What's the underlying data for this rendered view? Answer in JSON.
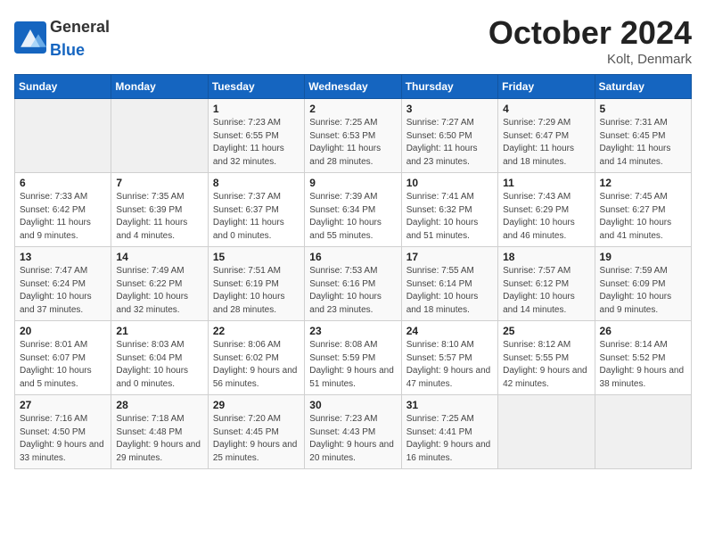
{
  "logo": {
    "general": "General",
    "blue": "Blue"
  },
  "header": {
    "title": "October 2024",
    "location": "Kolt, Denmark"
  },
  "weekdays": [
    "Sunday",
    "Monday",
    "Tuesday",
    "Wednesday",
    "Thursday",
    "Friday",
    "Saturday"
  ],
  "weeks": [
    [
      {
        "day": "",
        "empty": true
      },
      {
        "day": "",
        "empty": true
      },
      {
        "day": "1",
        "sunrise": "Sunrise: 7:23 AM",
        "sunset": "Sunset: 6:55 PM",
        "daylight": "Daylight: 11 hours and 32 minutes."
      },
      {
        "day": "2",
        "sunrise": "Sunrise: 7:25 AM",
        "sunset": "Sunset: 6:53 PM",
        "daylight": "Daylight: 11 hours and 28 minutes."
      },
      {
        "day": "3",
        "sunrise": "Sunrise: 7:27 AM",
        "sunset": "Sunset: 6:50 PM",
        "daylight": "Daylight: 11 hours and 23 minutes."
      },
      {
        "day": "4",
        "sunrise": "Sunrise: 7:29 AM",
        "sunset": "Sunset: 6:47 PM",
        "daylight": "Daylight: 11 hours and 18 minutes."
      },
      {
        "day": "5",
        "sunrise": "Sunrise: 7:31 AM",
        "sunset": "Sunset: 6:45 PM",
        "daylight": "Daylight: 11 hours and 14 minutes."
      }
    ],
    [
      {
        "day": "6",
        "sunrise": "Sunrise: 7:33 AM",
        "sunset": "Sunset: 6:42 PM",
        "daylight": "Daylight: 11 hours and 9 minutes."
      },
      {
        "day": "7",
        "sunrise": "Sunrise: 7:35 AM",
        "sunset": "Sunset: 6:39 PM",
        "daylight": "Daylight: 11 hours and 4 minutes."
      },
      {
        "day": "8",
        "sunrise": "Sunrise: 7:37 AM",
        "sunset": "Sunset: 6:37 PM",
        "daylight": "Daylight: 11 hours and 0 minutes."
      },
      {
        "day": "9",
        "sunrise": "Sunrise: 7:39 AM",
        "sunset": "Sunset: 6:34 PM",
        "daylight": "Daylight: 10 hours and 55 minutes."
      },
      {
        "day": "10",
        "sunrise": "Sunrise: 7:41 AM",
        "sunset": "Sunset: 6:32 PM",
        "daylight": "Daylight: 10 hours and 51 minutes."
      },
      {
        "day": "11",
        "sunrise": "Sunrise: 7:43 AM",
        "sunset": "Sunset: 6:29 PM",
        "daylight": "Daylight: 10 hours and 46 minutes."
      },
      {
        "day": "12",
        "sunrise": "Sunrise: 7:45 AM",
        "sunset": "Sunset: 6:27 PM",
        "daylight": "Daylight: 10 hours and 41 minutes."
      }
    ],
    [
      {
        "day": "13",
        "sunrise": "Sunrise: 7:47 AM",
        "sunset": "Sunset: 6:24 PM",
        "daylight": "Daylight: 10 hours and 37 minutes."
      },
      {
        "day": "14",
        "sunrise": "Sunrise: 7:49 AM",
        "sunset": "Sunset: 6:22 PM",
        "daylight": "Daylight: 10 hours and 32 minutes."
      },
      {
        "day": "15",
        "sunrise": "Sunrise: 7:51 AM",
        "sunset": "Sunset: 6:19 PM",
        "daylight": "Daylight: 10 hours and 28 minutes."
      },
      {
        "day": "16",
        "sunrise": "Sunrise: 7:53 AM",
        "sunset": "Sunset: 6:16 PM",
        "daylight": "Daylight: 10 hours and 23 minutes."
      },
      {
        "day": "17",
        "sunrise": "Sunrise: 7:55 AM",
        "sunset": "Sunset: 6:14 PM",
        "daylight": "Daylight: 10 hours and 18 minutes."
      },
      {
        "day": "18",
        "sunrise": "Sunrise: 7:57 AM",
        "sunset": "Sunset: 6:12 PM",
        "daylight": "Daylight: 10 hours and 14 minutes."
      },
      {
        "day": "19",
        "sunrise": "Sunrise: 7:59 AM",
        "sunset": "Sunset: 6:09 PM",
        "daylight": "Daylight: 10 hours and 9 minutes."
      }
    ],
    [
      {
        "day": "20",
        "sunrise": "Sunrise: 8:01 AM",
        "sunset": "Sunset: 6:07 PM",
        "daylight": "Daylight: 10 hours and 5 minutes."
      },
      {
        "day": "21",
        "sunrise": "Sunrise: 8:03 AM",
        "sunset": "Sunset: 6:04 PM",
        "daylight": "Daylight: 10 hours and 0 minutes."
      },
      {
        "day": "22",
        "sunrise": "Sunrise: 8:06 AM",
        "sunset": "Sunset: 6:02 PM",
        "daylight": "Daylight: 9 hours and 56 minutes."
      },
      {
        "day": "23",
        "sunrise": "Sunrise: 8:08 AM",
        "sunset": "Sunset: 5:59 PM",
        "daylight": "Daylight: 9 hours and 51 minutes."
      },
      {
        "day": "24",
        "sunrise": "Sunrise: 8:10 AM",
        "sunset": "Sunset: 5:57 PM",
        "daylight": "Daylight: 9 hours and 47 minutes."
      },
      {
        "day": "25",
        "sunrise": "Sunrise: 8:12 AM",
        "sunset": "Sunset: 5:55 PM",
        "daylight": "Daylight: 9 hours and 42 minutes."
      },
      {
        "day": "26",
        "sunrise": "Sunrise: 8:14 AM",
        "sunset": "Sunset: 5:52 PM",
        "daylight": "Daylight: 9 hours and 38 minutes."
      }
    ],
    [
      {
        "day": "27",
        "sunrise": "Sunrise: 7:16 AM",
        "sunset": "Sunset: 4:50 PM",
        "daylight": "Daylight: 9 hours and 33 minutes."
      },
      {
        "day": "28",
        "sunrise": "Sunrise: 7:18 AM",
        "sunset": "Sunset: 4:48 PM",
        "daylight": "Daylight: 9 hours and 29 minutes."
      },
      {
        "day": "29",
        "sunrise": "Sunrise: 7:20 AM",
        "sunset": "Sunset: 4:45 PM",
        "daylight": "Daylight: 9 hours and 25 minutes."
      },
      {
        "day": "30",
        "sunrise": "Sunrise: 7:23 AM",
        "sunset": "Sunset: 4:43 PM",
        "daylight": "Daylight: 9 hours and 20 minutes."
      },
      {
        "day": "31",
        "sunrise": "Sunrise: 7:25 AM",
        "sunset": "Sunset: 4:41 PM",
        "daylight": "Daylight: 9 hours and 16 minutes."
      },
      {
        "day": "",
        "empty": true
      },
      {
        "day": "",
        "empty": true
      }
    ]
  ]
}
